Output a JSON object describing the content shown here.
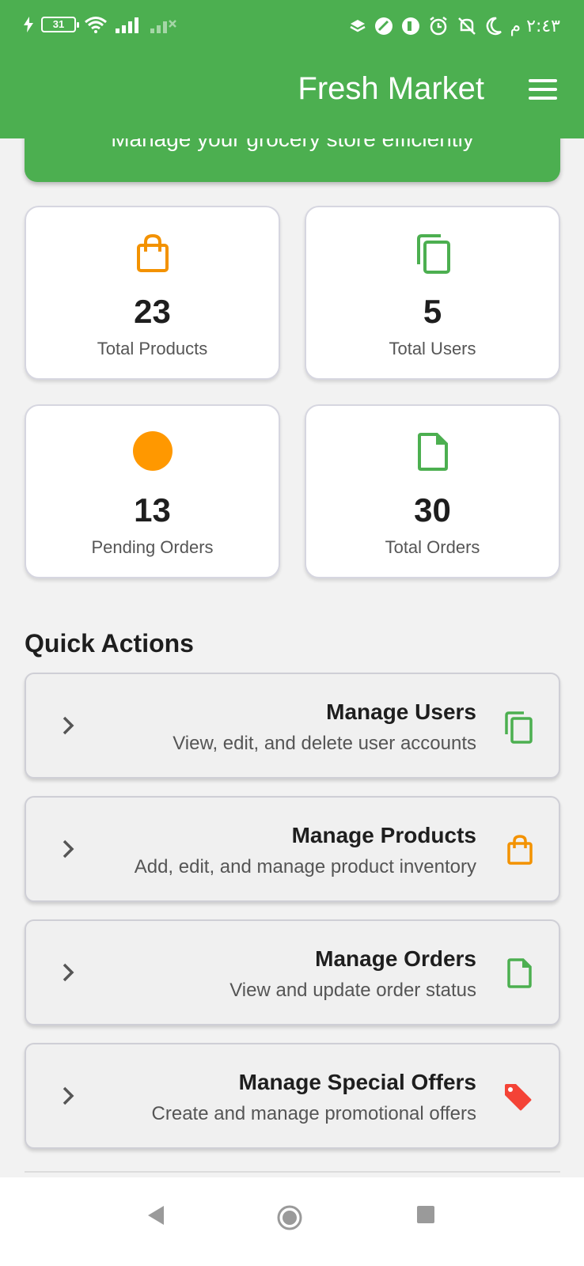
{
  "status_bar": {
    "battery": "31",
    "time": "٢:٤٣ م"
  },
  "app_bar": {
    "title": "Fresh Market",
    "menu_icon": "hamburger-menu-icon"
  },
  "welcome": {
    "subtitle": "Manage your grocery store efficiently"
  },
  "stats": [
    {
      "icon": "shopping-bag-icon",
      "value": "23",
      "label": "Total Products",
      "color": "#f39200"
    },
    {
      "icon": "copy-icon",
      "value": "5",
      "label": "Total Users",
      "color": "#4caf50"
    },
    {
      "icon": "circle-icon",
      "value": "13",
      "label": "Pending Orders",
      "color": "#ff9800"
    },
    {
      "icon": "file-icon",
      "value": "30",
      "label": "Total Orders",
      "color": "#4caf50"
    }
  ],
  "quick_actions": {
    "title": "Quick Actions",
    "items": [
      {
        "title": "Manage Users",
        "subtitle": "View, edit, and delete user accounts",
        "icon": "copy-icon",
        "color": "#4caf50"
      },
      {
        "title": "Manage Products",
        "subtitle": "Add, edit, and manage product inventory",
        "icon": "shopping-bag-icon",
        "color": "#f39200"
      },
      {
        "title": "Manage Orders",
        "subtitle": "View and update order status",
        "icon": "file-icon",
        "color": "#4caf50"
      },
      {
        "title": "Manage Special Offers",
        "subtitle": "Create and manage promotional offers",
        "icon": "tag-icon",
        "color": "#f44336"
      }
    ]
  },
  "colors": {
    "primary": "#4caf50",
    "accent": "#f39200",
    "background": "#f2f2f2"
  }
}
